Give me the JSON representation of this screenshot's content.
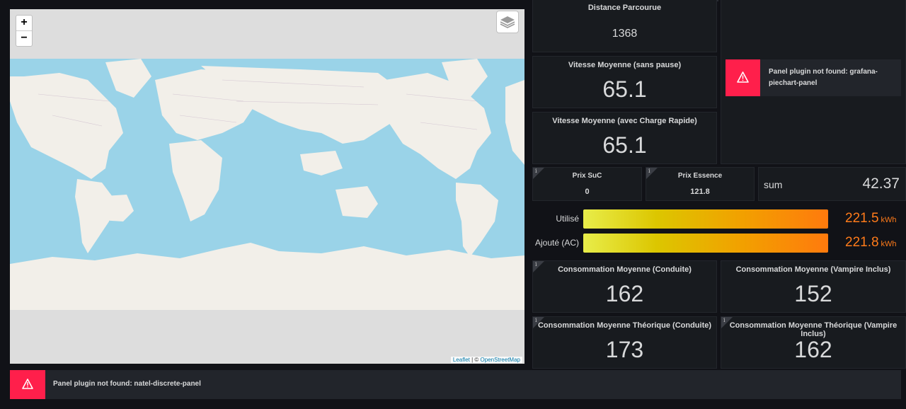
{
  "map": {
    "zoom_in": "+",
    "zoom_out": "−",
    "attribution": {
      "leaflet": "Leaflet",
      "separator": " | © ",
      "osm": "OpenStreetMap"
    }
  },
  "distance": {
    "title": "Distance Parcourue",
    "value": "1368"
  },
  "vitesse_sans_pause": {
    "title": "Vitesse Moyenne (sans pause)",
    "value": "65.1"
  },
  "vitesse_charge": {
    "title": "Vitesse Moyenne (avec Charge Rapide)",
    "value": "65.1"
  },
  "piechart_error": {
    "line1": "Panel plugin not found: grafana-",
    "line2": "piechart-panel"
  },
  "prix_suc": {
    "title": "Prix SuC",
    "value": "0"
  },
  "prix_essence": {
    "title": "Prix Essence",
    "value": "121.8"
  },
  "sum": {
    "label": "sum",
    "value": "42.37"
  },
  "energy": {
    "items": [
      {
        "label": "Utilisé",
        "value": "221.5",
        "unit": "kWh",
        "fraction": 1.0
      },
      {
        "label": "Ajouté (AC)",
        "value": "221.8",
        "unit": "kWh",
        "fraction": 1.0
      }
    ]
  },
  "conso_conduite": {
    "title": "Consommation Moyenne (Conduite)",
    "value": "162"
  },
  "conso_vampire": {
    "title": "Consommation Moyenne (Vampire Inclus)",
    "value": "152"
  },
  "conso_theo_conduite": {
    "title": "Consommation Moyenne Théorique (Conduite)",
    "value": "173"
  },
  "conso_theo_vampire": {
    "title": "Consommation Moyenne Théorique (Vampire Inclus)",
    "value": "162"
  },
  "discrete_error": {
    "text": "Panel plugin not found: natel-discrete-panel"
  },
  "colors": {
    "background": "#111217",
    "panel": "#181b1f",
    "error": "#ff1f4b",
    "ocean": "#9ad3e8",
    "land": "#f2efe9",
    "value_orange": "#ff7b1a"
  },
  "icons": [
    "warning-icon",
    "info-icon",
    "layers-icon"
  ]
}
